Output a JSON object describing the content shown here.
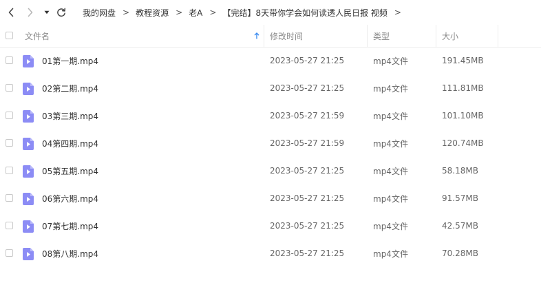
{
  "colors": {
    "accent": "#3c8cf0",
    "video_icon": "#8c8cf5",
    "border": "#ececec"
  },
  "breadcrumb": [
    "我的网盘",
    "教程资源",
    "老A",
    "【完结】8天带你学会如何读透人民日报 视频"
  ],
  "breadcrumb_separator": ">",
  "columns": {
    "name": "文件名",
    "modified": "修改时间",
    "type": "类型",
    "size": "大小"
  },
  "files": [
    {
      "name": "01第一期.mp4",
      "modified": "2023-05-27 21:25",
      "type": "mp4文件",
      "size": "191.45MB"
    },
    {
      "name": "02第二期.mp4",
      "modified": "2023-05-27 21:25",
      "type": "mp4文件",
      "size": "111.81MB"
    },
    {
      "name": "03第三期.mp4",
      "modified": "2023-05-27 21:59",
      "type": "mp4文件",
      "size": "101.10MB"
    },
    {
      "name": "04第四期.mp4",
      "modified": "2023-05-27 21:59",
      "type": "mp4文件",
      "size": "120.74MB"
    },
    {
      "name": "05第五期.mp4",
      "modified": "2023-05-27 21:25",
      "type": "mp4文件",
      "size": "58.18MB"
    },
    {
      "name": "06第六期.mp4",
      "modified": "2023-05-27 21:25",
      "type": "mp4文件",
      "size": "91.57MB"
    },
    {
      "name": "07第七期.mp4",
      "modified": "2023-05-27 21:25",
      "type": "mp4文件",
      "size": "42.57MB"
    },
    {
      "name": "08第八期.mp4",
      "modified": "2023-05-27 21:25",
      "type": "mp4文件",
      "size": "70.28MB"
    }
  ]
}
